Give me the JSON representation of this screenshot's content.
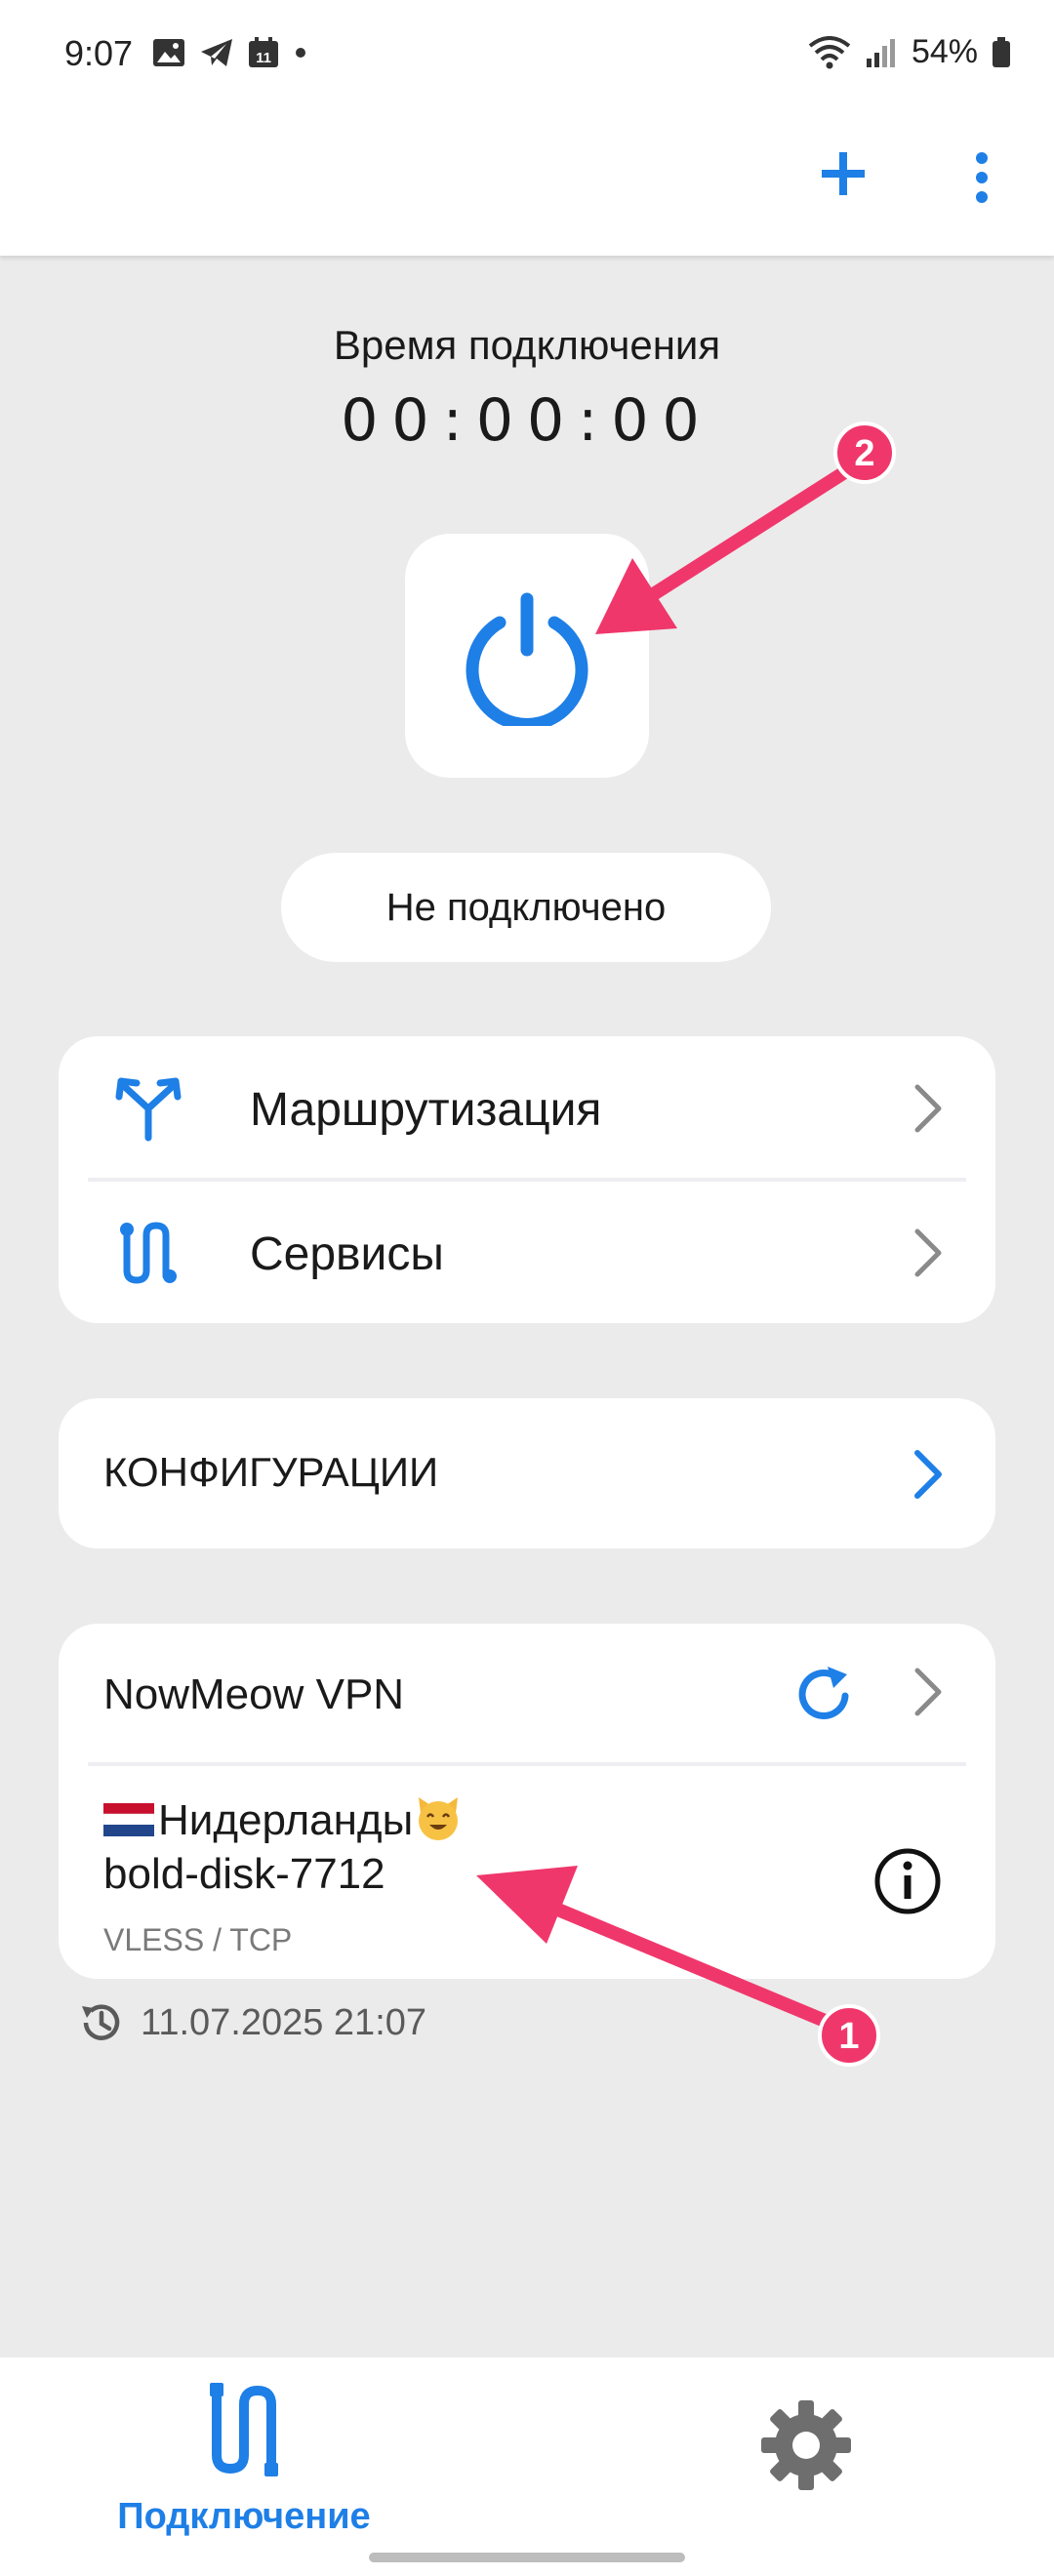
{
  "status_bar": {
    "time": "9:07",
    "notif_badge": "11",
    "battery": "54%",
    "icons": [
      "image-icon",
      "telegram-icon",
      "calendar-icon",
      "dot-icon",
      "wifi-icon",
      "signal-icon",
      "battery-icon"
    ]
  },
  "app_bar": {
    "actions": [
      "plus-icon",
      "more-vert-icon"
    ],
    "accent_color": "#1e7fe6"
  },
  "connection": {
    "label": "Время подключения",
    "timer": "00:00:00",
    "status": "Не подключено"
  },
  "menu": {
    "items": [
      {
        "label": "Маршрутизация",
        "icon": "routing-icon"
      },
      {
        "label": "Сервисы",
        "icon": "services-icon"
      }
    ]
  },
  "configs": {
    "label": "КОНФИГУРАЦИИ"
  },
  "profile": {
    "name": "NowMeow VPN",
    "server_title": "Нидерланды",
    "server_flag": "netherlands-flag-icon",
    "server_emoji": "smiling-cat-icon",
    "server_id": "bold-disk-7712",
    "protocol": "VLESS / TCP",
    "last_updated": "11.07.2025 21:07"
  },
  "annotations": {
    "badge_1": "1",
    "badge_2": "2",
    "color": "#f0376b"
  },
  "bottom_nav": {
    "tabs": [
      {
        "label": "Подключение",
        "icon": "connection-icon",
        "active": true
      },
      {
        "label": "",
        "icon": "gear-icon",
        "active": false
      }
    ]
  }
}
